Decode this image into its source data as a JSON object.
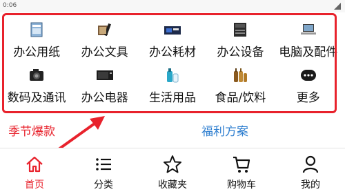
{
  "status_bar": {
    "time": "0:06"
  },
  "categories": [
    {
      "label": "办公用纸",
      "icon": "paper-ream-icon"
    },
    {
      "label": "办公文具",
      "icon": "stationery-set-icon"
    },
    {
      "label": "办公耗材",
      "icon": "toner-cartridge-icon"
    },
    {
      "label": "办公设备",
      "icon": "printer-icon"
    },
    {
      "label": "电脑及配件",
      "icon": "laptop-icon"
    },
    {
      "label": "数码及通讯",
      "icon": "camera-icon"
    },
    {
      "label": "办公电器",
      "icon": "microwave-icon"
    },
    {
      "label": "生活用品",
      "icon": "toiletries-icon"
    },
    {
      "label": "食品/饮料",
      "icon": "beverage-bottles-icon"
    },
    {
      "label": "更多",
      "icon": "more-dots-icon"
    }
  ],
  "sections": {
    "seasonal": "季节爆款",
    "welfare": "福利方案"
  },
  "bottom_nav": [
    {
      "label": "首页",
      "icon": "home-icon",
      "active": true
    },
    {
      "label": "分类",
      "icon": "list-icon",
      "active": false
    },
    {
      "label": "收藏夹",
      "icon": "star-icon",
      "active": false
    },
    {
      "label": "购物车",
      "icon": "cart-icon",
      "active": false
    },
    {
      "label": "我的",
      "icon": "user-icon",
      "active": false
    }
  ],
  "colors": {
    "accent": "#e8222c",
    "link_blue": "#2f7fd0",
    "text": "#111111"
  }
}
